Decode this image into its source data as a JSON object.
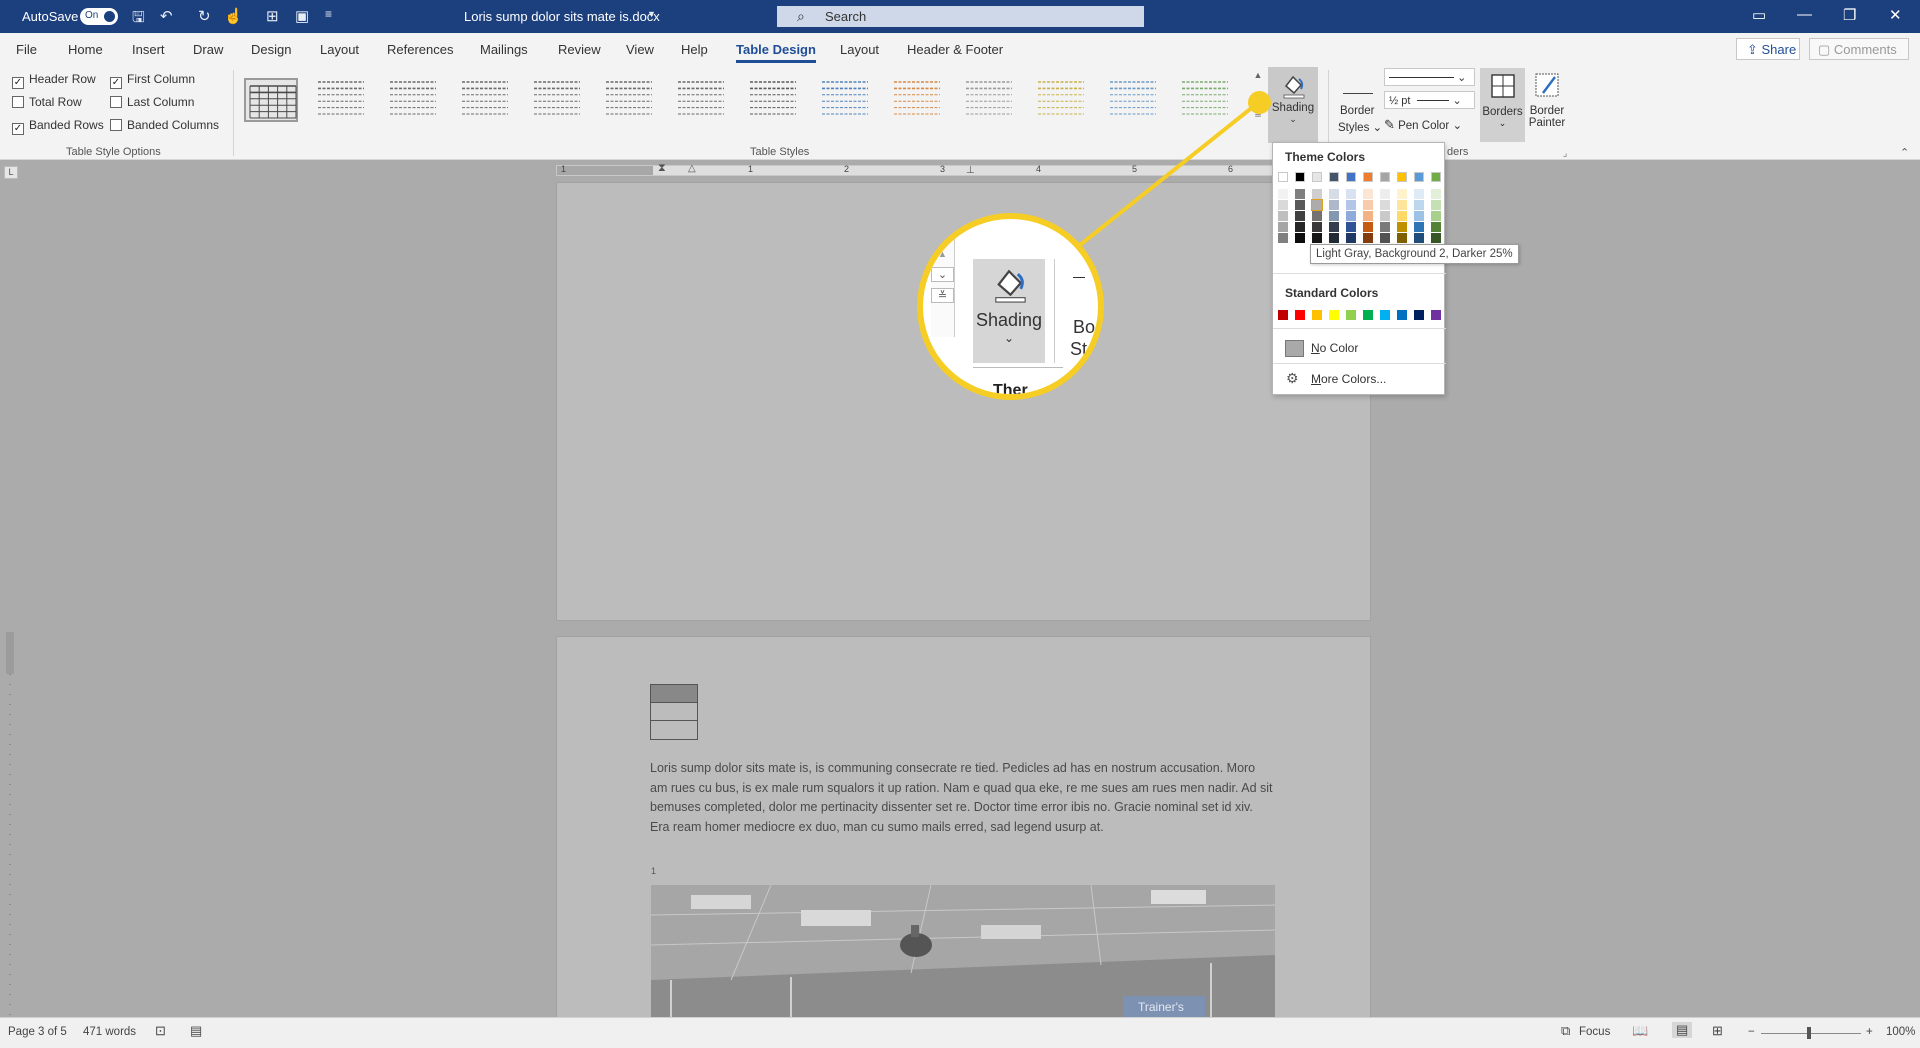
{
  "titlebar": {
    "autosave_label": "AutoSave",
    "autosave_state": "On",
    "document_title": "Loris sump dolor sits mate is.docx",
    "search_placeholder": "Search"
  },
  "tabs": [
    "File",
    "Home",
    "Insert",
    "Draw",
    "Design",
    "Layout",
    "References",
    "Mailings",
    "Review",
    "View",
    "Help",
    "Table Design",
    "Layout",
    "Header & Footer"
  ],
  "active_tab": "Table Design",
  "share_label": "Share",
  "comments_label": "Comments",
  "table_style_options": {
    "group_label": "Table Style Options",
    "options": [
      {
        "label": "Header Row",
        "checked": true
      },
      {
        "label": "Total Row",
        "checked": false
      },
      {
        "label": "Banded Rows",
        "checked": true
      },
      {
        "label": "First Column",
        "checked": true
      },
      {
        "label": "Last Column",
        "checked": false
      },
      {
        "label": "Banded Columns",
        "checked": false
      }
    ]
  },
  "table_styles": {
    "group_label": "Table Styles",
    "colors": [
      "#4a4a4a",
      "#6b6b6b",
      "#6b6b6b",
      "#6b6b6b",
      "#6b6b6b",
      "#6b6b6b",
      "#6b6b6b",
      "#5a5a5a",
      "#4f81bd",
      "#d88a45",
      "#9a9a9a",
      "#c9b24a",
      "#6b9bc8",
      "#7aab6d"
    ]
  },
  "shading": {
    "label": "Shading",
    "icon": "paint-bucket-icon"
  },
  "borders_group": {
    "border_styles_label1": "Border",
    "border_styles_label2": "Styles",
    "weight": "½ pt",
    "pen_color_label": "Pen Color",
    "borders_label": "Borders",
    "border_painter_label1": "Border",
    "border_painter_label2": "Painter",
    "group_label_partial": "ders"
  },
  "ruler": {
    "numbers": [
      "1",
      "1",
      "2",
      "3",
      "4",
      "5",
      "6"
    ]
  },
  "dropdown": {
    "theme_header": "Theme Colors",
    "theme_top_row": [
      "#ffffff",
      "#000000",
      "#e7e6e6",
      "#44546a",
      "#4472c4",
      "#ed7d31",
      "#a5a5a5",
      "#ffc000",
      "#5b9bd5",
      "#70ad47"
    ],
    "theme_shades": [
      [
        "#f2f2f2",
        "#d9d9d9",
        "#bfbfbf",
        "#a6a6a6",
        "#808080"
      ],
      [
        "#7f7f7f",
        "#595959",
        "#404040",
        "#262626",
        "#0d0d0d"
      ],
      [
        "#d0cece",
        "#aeabab",
        "#757171",
        "#3a3838",
        "#171616"
      ],
      [
        "#d6dce4",
        "#adb9ca",
        "#8497b0",
        "#333f4f",
        "#222a35"
      ],
      [
        "#d9e2f3",
        "#b4c6e7",
        "#8eaadb",
        "#2f5496",
        "#1f3864"
      ],
      [
        "#fbe5d5",
        "#f7cbac",
        "#f4b183",
        "#c55a11",
        "#833c0b"
      ],
      [
        "#ededed",
        "#dbdbdb",
        "#c9c9c9",
        "#7b7b7b",
        "#525252"
      ],
      [
        "#fff2cc",
        "#fee599",
        "#ffd965",
        "#bf9000",
        "#7f6000"
      ],
      [
        "#deebf6",
        "#bdd7ee",
        "#9cc3e5",
        "#2e75b5",
        "#1e4e79"
      ],
      [
        "#e2efd9",
        "#c5e0b3",
        "#a8d08d",
        "#538135",
        "#375623"
      ]
    ],
    "standard_header": "Standard Colors",
    "standard_colors": [
      "#c00000",
      "#ff0000",
      "#ffc000",
      "#ffff00",
      "#92d050",
      "#00b050",
      "#00b0f0",
      "#0070c0",
      "#002060",
      "#7030a0"
    ],
    "no_color_label_u": "N",
    "no_color_label_rest": "o Color",
    "more_colors_label_u": "M",
    "more_colors_label_rest": "ore Colors..."
  },
  "tooltip": "Light Gray, Background 2, Darker 25%",
  "zoom": {
    "shading_label": "Shading",
    "partial_right1": "Bo",
    "partial_right2": "St",
    "partial_bottom": "Ther"
  },
  "document": {
    "paragraph": "Loris sump dolor sits mate is, is communing consecrate re tied. Pedicles ad has en nostrum accusation. Moro am rues cu bus, is ex male rum squalors it up ration. Nam e quad qua eke, re me sues am rues men nadir. Ad sit bemuses completed, dolor me pertinacity dissenter set re. Doctor time error ibis no. Gracie nominal set id xiv. Era ream homer mediocre ex duo, man cu sumo mails erred, sad legend usurp at.",
    "footnote": "1",
    "photo_caption": "Trainer's"
  },
  "status": {
    "page": "Page 3 of 5",
    "words": "471 words",
    "focus": "Focus",
    "zoom": "100%"
  }
}
